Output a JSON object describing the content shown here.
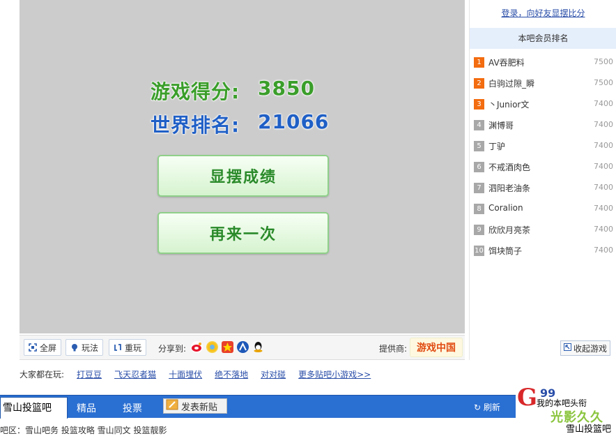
{
  "game": {
    "score_label": "游戏得分:",
    "score_value": "3850",
    "rank_label": "世界排名:",
    "rank_value": "21066",
    "share_button": "显摆成绩",
    "retry_button": "再来一次"
  },
  "toolbar": {
    "fullscreen": "全屏",
    "howto": "玩法",
    "replay": "重玩",
    "share_to": "分享到:",
    "provider": "提供商:",
    "provider_logo": "游戏中国"
  },
  "sidebar": {
    "login_link": "登录，向好友显摆比分",
    "ranking_title": "本吧会员排名",
    "ranks": [
      {
        "num": "1",
        "name": "AV吞肥料",
        "score": "7500",
        "badge_color": "#f36c0f"
      },
      {
        "num": "2",
        "name": "白驹过隙_瞬",
        "score": "7500",
        "badge_color": "#f36c0f"
      },
      {
        "num": "3",
        "name": "丶Junior文",
        "score": "7400",
        "badge_color": "#f36c0f"
      },
      {
        "num": "4",
        "name": "渊博哥",
        "score": "7400",
        "badge_color": "#a8a8a8"
      },
      {
        "num": "5",
        "name": "丁驴",
        "score": "7400",
        "badge_color": "#a8a8a8"
      },
      {
        "num": "6",
        "name": "不戒酒肉色",
        "score": "7400",
        "badge_color": "#a8a8a8"
      },
      {
        "num": "7",
        "name": "泗阳老油条",
        "score": "7400",
        "badge_color": "#a8a8a8"
      },
      {
        "num": "8",
        "name": "Coralion",
        "score": "7400",
        "badge_color": "#a8a8a8"
      },
      {
        "num": "9",
        "name": "欣欣月亮茶",
        "score": "7400",
        "badge_color": "#a8a8a8"
      },
      {
        "num": "10",
        "name": "饵块筒子",
        "score": "7400",
        "badge_color": "#a8a8a8"
      }
    ],
    "collapse_button": "收起游戏"
  },
  "playing": {
    "label": "大家都在玩:",
    "games": [
      "打豆豆",
      "飞天忍者猫",
      "十面埋伏",
      "绝不落地",
      "对对碰",
      "更多贴吧小游戏>>"
    ]
  },
  "nav": {
    "forum_name": "雪山投篮吧",
    "tab_featured": "精品",
    "tab_vote": "投票",
    "post_button": "发表新贴",
    "refresh": "刷新"
  },
  "sub_links": "吧区：雪山吧务  投篮攻略  雪山同文  投篮靓影",
  "corner": {
    "line1": "99",
    "line2": "我的本吧头衔",
    "line3": "光影久久",
    "line4": "雪山投篮吧"
  },
  "colors": {
    "game_bg": "#cccccc",
    "score_green": "#3a9e2a",
    "rank_blue": "#1f5fc6",
    "nav_blue": "#2a6fd2",
    "top3_badge": "#f36c0f",
    "other_badge": "#a8a8a8"
  }
}
